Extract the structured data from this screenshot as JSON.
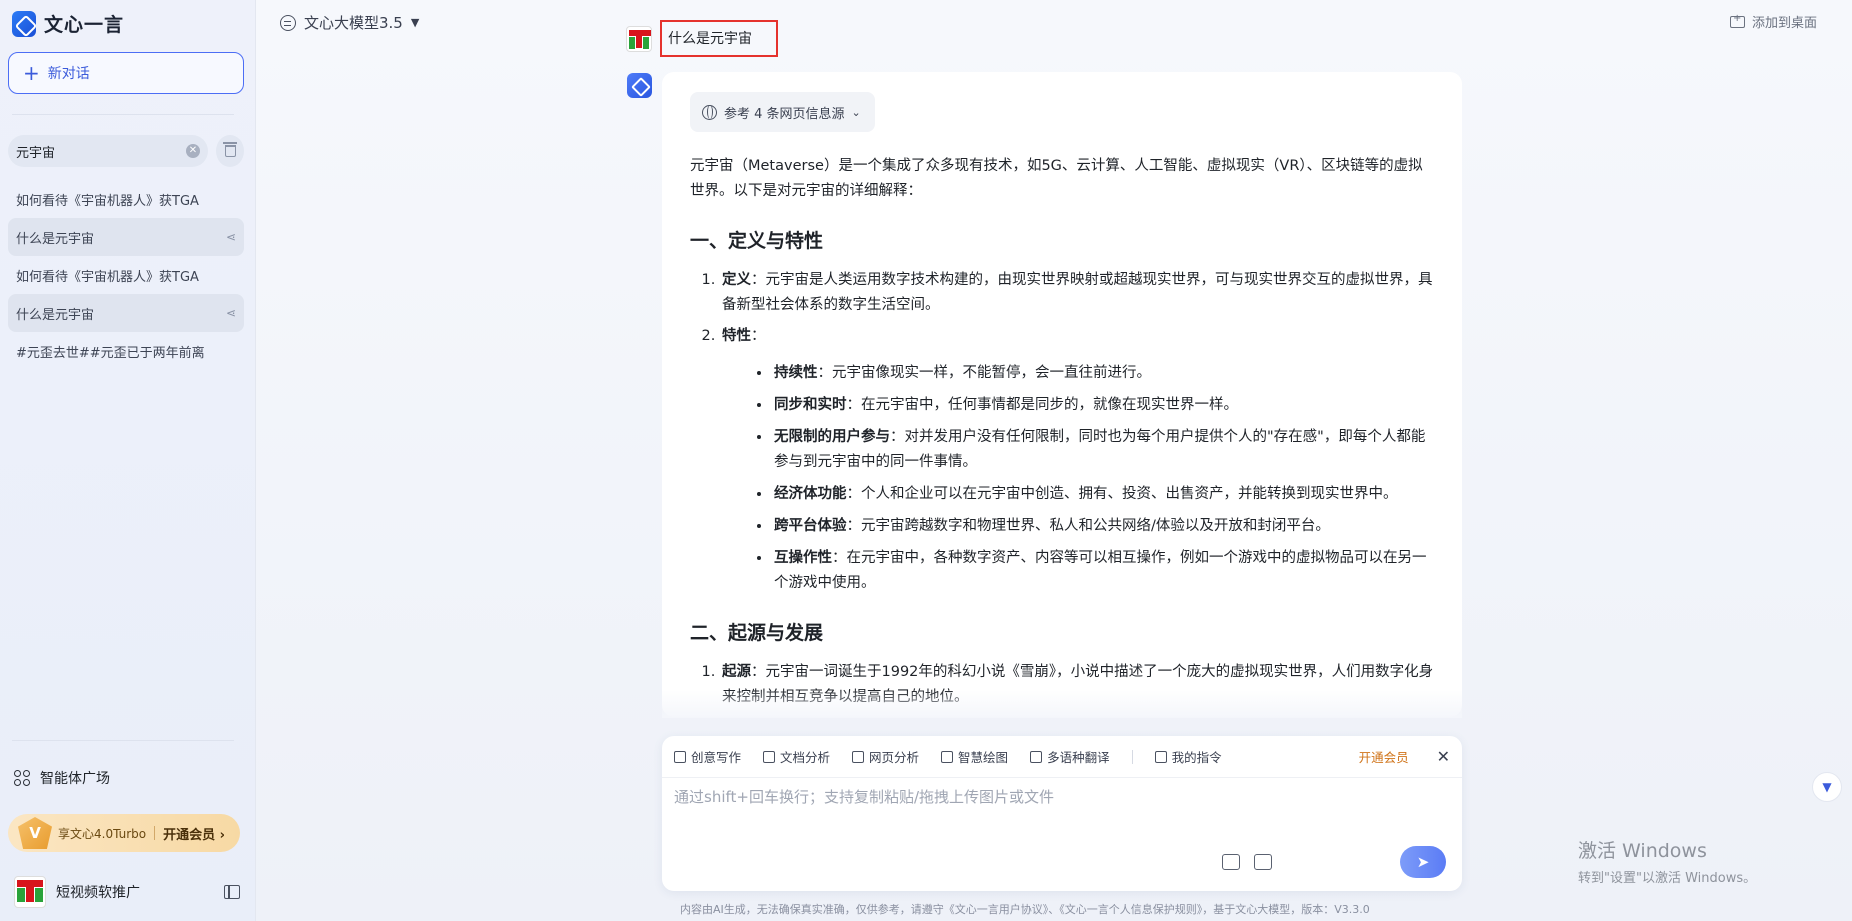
{
  "app": {
    "name": "文心一言"
  },
  "sidebar": {
    "new_chat_label": "新对话",
    "search_value": "元宇宙",
    "history": [
      {
        "label": "如何看待《宇宙机器人》获TGA",
        "active": false
      },
      {
        "label": "什么是元宇宙",
        "active": true
      },
      {
        "label": "如何看待《宇宙机器人》获TGA",
        "active": false
      },
      {
        "label": "什么是元宇宙",
        "active": true
      },
      {
        "label": "#元歪去世##元歪已于两年前离",
        "active": false
      }
    ],
    "agents_label": "智能体广场",
    "vip_banner": {
      "text": "享文心4.0Turbo",
      "cta": "开通会员 ›"
    },
    "user_name": "短视频软推广"
  },
  "topbar": {
    "model_label": "文心大模型3.5",
    "add_desktop_label": "添加到桌面"
  },
  "conversation": {
    "user_question": "什么是元宇宙",
    "sources_label": "参考 4 条网页信息源",
    "intro": "元宇宙（Metaverse）是一个集成了众多现有技术，如5G、云计算、人工智能、虚拟现实（VR）、区块链等的虚拟世界。以下是对元宇宙的详细解释：",
    "section1_title": "一、定义与特性",
    "def_label": "定义",
    "def_text": "：元宇宙是人类运用数字技术构建的，由现实世界映射或超越现实世界，可与现实世界交互的虚拟世界，具备新型社会体系的数字生活空间。",
    "traits_label": "特性",
    "traits_colon": "：",
    "traits": [
      {
        "label": "持续性",
        "text": "：元宇宙像现实一样，不能暂停，会一直往前进行。"
      },
      {
        "label": "同步和实时",
        "text": "：在元宇宙中，任何事情都是同步的，就像在现实世界一样。"
      },
      {
        "label": "无限制的用户参与",
        "text": "：对并发用户没有任何限制，同时也为每个用户提供个人的\"存在感\"，即每个人都能参与到元宇宙中的同一件事情。"
      },
      {
        "label": "经济体功能",
        "text": "：个人和企业可以在元宇宙中创造、拥有、投资、出售资产，并能转换到现实世界中。"
      },
      {
        "label": "跨平台体验",
        "text": "：元宇宙跨越数字和物理世界、私人和公共网络/体验以及开放和封闭平台。"
      },
      {
        "label": "互操作性",
        "text": "：在元宇宙中，各种数字资产、内容等可以相互操作，例如一个游戏中的虚拟物品可以在另一个游戏中使用。"
      }
    ],
    "section2_title": "二、起源与发展",
    "origin_label": "起源",
    "origin_text": "：元宇宙一词诞生于1992年的科幻小说《雪崩》，小说中描述了一个庞大的虚拟现实世界，人们用数字化身来控制并相互竞争以提高自己的地位。"
  },
  "composer": {
    "tools": [
      "创意写作",
      "文档分析",
      "网页分析",
      "智慧绘图",
      "多语种翻译",
      "我的指令"
    ],
    "vip_link": "开通会员",
    "placeholder": "通过shift+回车换行；支持复制粘贴/拖拽上传图片或文件"
  },
  "footer_note": "内容由AI生成，无法确保真实准确，仅供参考，请遵守《文心一言用户协议》、《文心一言个人信息保护规则》，基于文心大模型，版本：V3.3.0",
  "watermark": {
    "line1": "激活 Windows",
    "line2": "转到\"设置\"以激活 Windows。"
  }
}
